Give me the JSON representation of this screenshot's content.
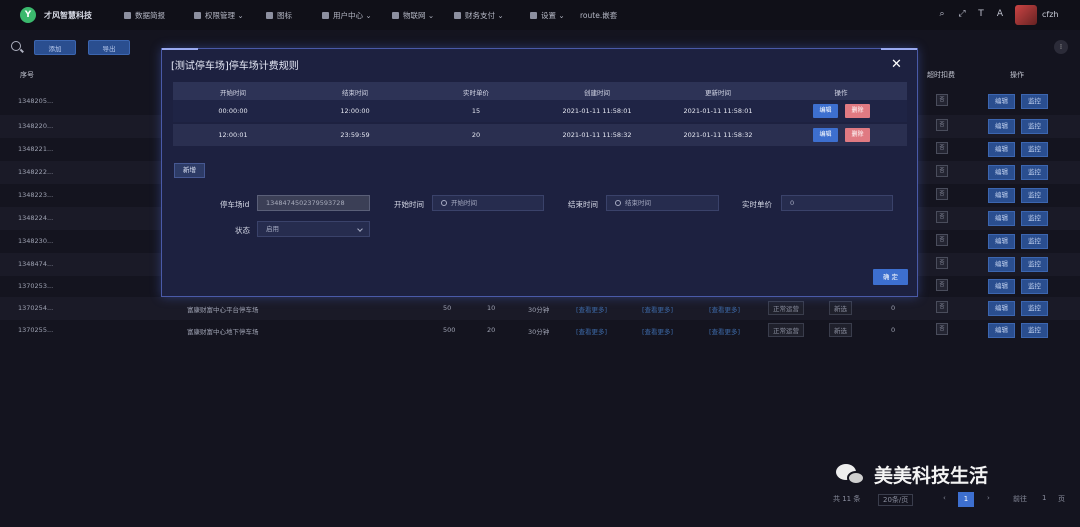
{
  "brand": "才风智慧科技",
  "nav": [
    "数据简报",
    "权限管理",
    "图标",
    "用户中心",
    "物联网",
    "财务支付",
    "设置",
    "route.嵌套"
  ],
  "user": {
    "name": "cfzh"
  },
  "toolbar": {
    "add": "添加",
    "export": "导出"
  },
  "table": {
    "col_id": "序号",
    "col_record": "超时扣费",
    "col_action": "操作",
    "rows": [
      {
        "id": "1348205..."
      },
      {
        "id": "1348220..."
      },
      {
        "id": "1348221..."
      },
      {
        "id": "1348222..."
      },
      {
        "id": "1348223..."
      },
      {
        "id": "1348224..."
      },
      {
        "id": "1348230..."
      },
      {
        "id": "1348474..."
      },
      {
        "id": "1370253..."
      },
      {
        "id": "1370254...",
        "name": "富康财富中心平台停车场",
        "a": "50",
        "b": "10",
        "c": "30分钟",
        "l1": "[查看更多]",
        "l2": "[查看更多]",
        "l3": "[查看更多]",
        "status": "正常运营",
        "tag": "新选",
        "zero": "0"
      },
      {
        "id": "1370255...",
        "name": "富康财富中心地下停车场",
        "a": "500",
        "b": "20",
        "c": "30分钟",
        "l1": "[查看更多]",
        "l2": "[查看更多]",
        "l3": "[查看更多]",
        "status": "正常运营",
        "tag": "新选",
        "zero": "0"
      }
    ],
    "row_mark": "否",
    "edit": "编辑",
    "monitor": "监控"
  },
  "pager": {
    "total": "共 11 条",
    "size": "20条/页",
    "page": "1",
    "goto": "前往",
    "goto_val": "1",
    "unit": "页"
  },
  "watermark": "美美科技生活",
  "modal": {
    "title": "[测试停车场]停车场计费规则",
    "columns": [
      "开始时间",
      "结束时间",
      "实时单价",
      "创建时间",
      "更新时间",
      "操作"
    ],
    "rows": [
      {
        "start": "00:00:00",
        "end": "12:00:00",
        "price": "15",
        "created": "2021-01-11 11:58:01",
        "updated": "2021-01-11 11:58:01"
      },
      {
        "start": "12:00:01",
        "end": "23:59:59",
        "price": "20",
        "created": "2021-01-11 11:58:32",
        "updated": "2021-01-11 11:58:32"
      }
    ],
    "edit": "编辑",
    "delete": "删除",
    "add": "新增",
    "form": {
      "parking_id_label": "停车场id",
      "parking_id_value": "1348474502379593728",
      "start_label": "开始时间",
      "start_placeholder": "开始时间",
      "end_label": "结束时间",
      "end_placeholder": "结束时间",
      "price_label": "实时单价",
      "price_value": "0",
      "status_label": "状态",
      "status_value": "启用"
    },
    "confirm": "确 定"
  }
}
